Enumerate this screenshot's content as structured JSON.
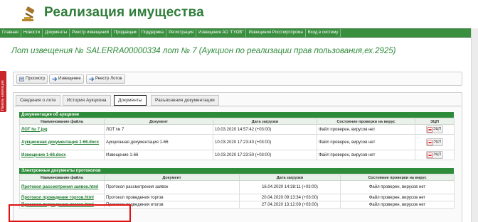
{
  "site": {
    "title": "Реализация имущества"
  },
  "nav": [
    "Главная",
    "Новости",
    "Документы",
    "Реестр извещений",
    "Продавцам",
    "Поддержка",
    "Регистрация",
    "Извещения АО \"ГУОВ\"",
    "Извещения Росспиртпрома",
    "Вход в систему"
  ],
  "side_panel": {
    "label": "Панель навигации"
  },
  "lot": {
    "title": "Лот извещения № SALERRA00000334 лот № 7 (Аукцион по реализации прав пользования,ех.2925)"
  },
  "toolbar": {
    "view": "Просмотр",
    "notice": "Извещение",
    "registry": "Реестр Лотов"
  },
  "tabs": [
    "Сведения о лоте",
    "История Аукциона",
    "Документы",
    "Разъяснения документации"
  ],
  "auction_docs": {
    "title": "Документация об аукционе",
    "headers": [
      "Наименование файла",
      "Документ",
      "Дата загрузки",
      "Состояние проверки на вирус",
      "ЭЦП"
    ],
    "rows": [
      {
        "file": "ЛОТ № 7.jpg",
        "doc": "ЛОТ № 7",
        "date": "10.03.2020 14:57:42 (+03:00)",
        "status": "Файл проверен, вирусов нет",
        "ecp": "ЭЦП"
      },
      {
        "file": "Аукционная документация 1-66.docx",
        "doc": "Аукционная документация 1-66",
        "date": "10.03.2020 17:23:40 (+03:00)",
        "status": "Файл проверен, вирусов нет",
        "ecp": "ЭЦП"
      },
      {
        "file": "Извещение 1-66.docx",
        "doc": "Извещение 1-66",
        "date": "10.03.2020 17:23:50 (+03:00)",
        "status": "Файл проверен, вирусов нет",
        "ecp": "ЭЦП"
      }
    ]
  },
  "protocol_docs": {
    "title": "Электронные документы протоколов",
    "headers": [
      "Наименование файла",
      "Документ",
      "Дата загрузки",
      "Состояние проверки на вирус"
    ],
    "rows": [
      {
        "file": "Протокол рассмотрения заявок.html",
        "doc": "Протокол рассмотрения заявок",
        "date": "16.04.2020 14:38:11 (+03:00)",
        "status": "Файл проверен, вирусов нет"
      },
      {
        "file": "Протокол проведения торгов.html",
        "doc": "Протокол проведения торгов",
        "date": "20.04.2020 09:13:34 (+03:00)",
        "status": "Файл проверен, вирусов нет"
      },
      {
        "file": "Протокол подведения итогов.html",
        "doc": "Протокол подведения итогов",
        "date": "27.04.2020 13:12:09 (+03:00)",
        "status": "Файл проверен, вирусов нет"
      }
    ]
  },
  "colors": {
    "brand_green": "#2f7d3a",
    "nav_green": "#3a8f3f",
    "highlight_red": "#e01010"
  },
  "icons": [
    "gavel-logo-icon",
    "view-icon",
    "notice-icon",
    "registry-icon",
    "ecp-pdf-icon"
  ]
}
